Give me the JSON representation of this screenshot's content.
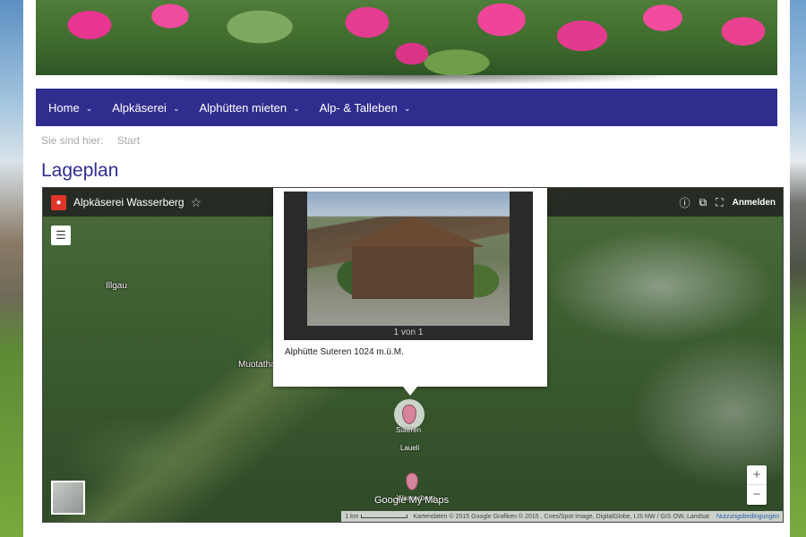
{
  "nav": {
    "items": [
      {
        "label": "Home"
      },
      {
        "label": "Alpkäserei"
      },
      {
        "label": "Alphütten mieten"
      },
      {
        "label": "Alp- & Talleben"
      }
    ]
  },
  "breadcrumb": {
    "prefix": "Sie sind hier:",
    "current": "Start"
  },
  "page": {
    "title": "Lageplan"
  },
  "map": {
    "title": "Alpkäserei Wasserberg",
    "signin": "Anmelden",
    "places": [
      "Illgau",
      "Muotatha",
      "Suteren",
      "Laueli",
      "Wasserberg"
    ],
    "popup": {
      "counter": "1 von 1",
      "caption": "Alphütte Suteren 1024 m.ü.M."
    },
    "google": "Google My Maps",
    "scale": "1 km",
    "attribution": "Kartendaten © 2015 Google Grafiken © 2015 , Cnes/Spot Image, DigitalGlobe, LIS NW / GIS OW, Landsat",
    "terms": "Nutzungsbedingungen",
    "zoom_in": "+",
    "zoom_out": "−"
  },
  "icons": {
    "chevron": "chevron-down-icon",
    "star": "star-icon",
    "info": "info-icon",
    "share": "share-icon",
    "fullscreen": "fullscreen-icon",
    "legend": "list-icon"
  },
  "colors": {
    "nav_bg": "#2f2e8f",
    "title": "#2f2e8f"
  }
}
